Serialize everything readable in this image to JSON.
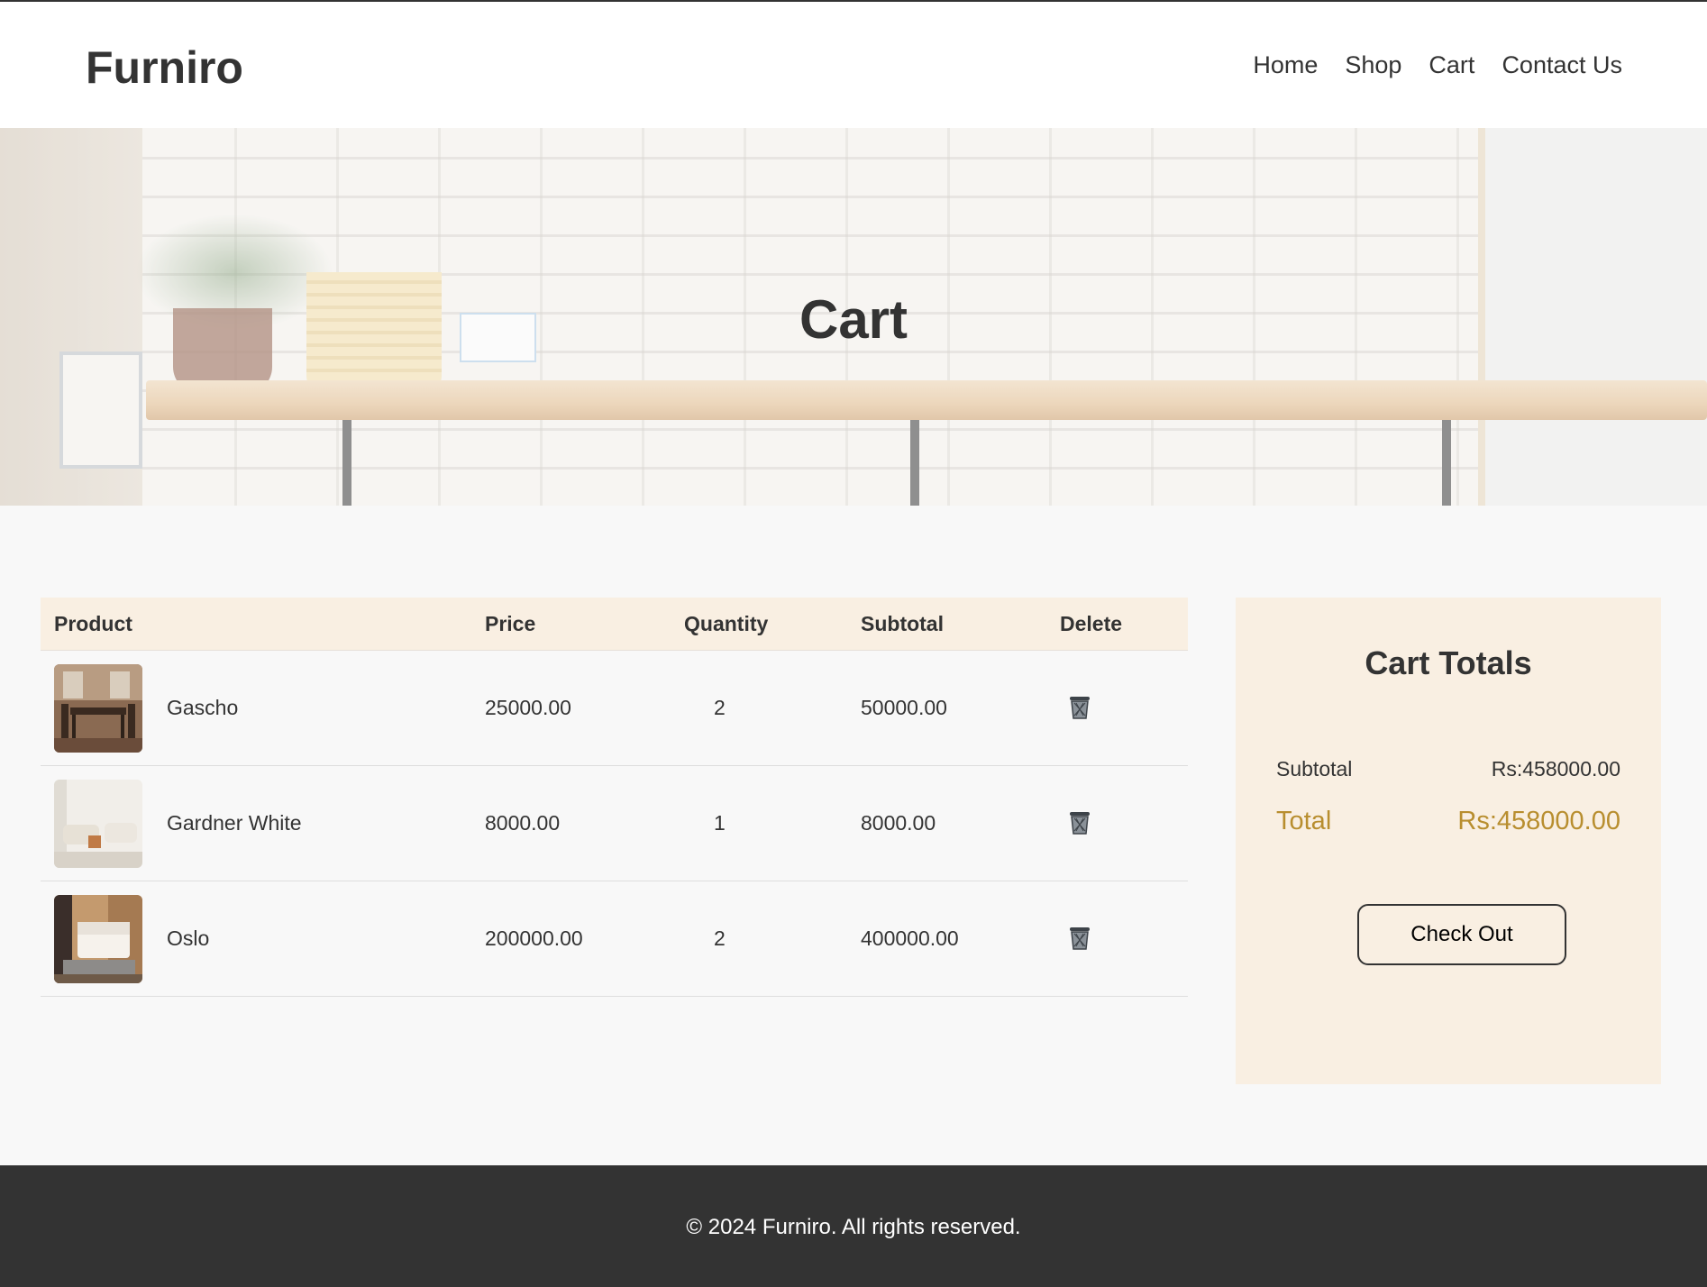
{
  "header": {
    "logo": "Furniro",
    "nav": [
      "Home",
      "Shop",
      "Cart",
      "Contact Us"
    ]
  },
  "hero": {
    "title": "Cart"
  },
  "table": {
    "headers": [
      "Product",
      "Price",
      "Quantity",
      "Subtotal",
      "Delete"
    ],
    "rows": [
      {
        "name": "Gascho",
        "price": "25000.00",
        "quantity": "2",
        "subtotal": "50000.00",
        "thumb_colors": [
          "#7a5a45",
          "#3a2b22"
        ]
      },
      {
        "name": "Gardner White",
        "price": "8000.00",
        "quantity": "1",
        "subtotal": "8000.00",
        "thumb_colors": [
          "#efece6",
          "#c9c2b7"
        ]
      },
      {
        "name": "Oslo",
        "price": "200000.00",
        "quantity": "2",
        "subtotal": "400000.00",
        "thumb_colors": [
          "#b58a62",
          "#f4f0ea"
        ]
      }
    ],
    "delete_icon": "trash-icon"
  },
  "totals": {
    "title": "Cart Totals",
    "subtotal_label": "Subtotal",
    "subtotal_value": "Rs:458000.00",
    "total_label": "Total",
    "total_value": "Rs:458000.00",
    "checkout_label": "Check Out",
    "accent_color": "#b88e2f"
  },
  "footer": {
    "text": "© 2024 Furniro. All rights reserved."
  }
}
